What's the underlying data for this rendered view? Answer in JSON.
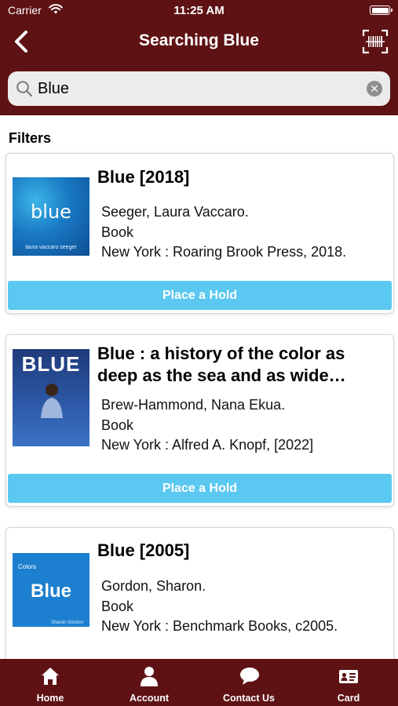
{
  "status_bar": {
    "carrier": "Carrier",
    "time": "11:25 AM"
  },
  "header": {
    "title": "Searching Blue"
  },
  "search": {
    "value": "Blue"
  },
  "filters_label": "Filters",
  "results": [
    {
      "title": "Blue [2018]",
      "author": "Seeger, Laura Vaccaro.",
      "format": "Book",
      "publisher": "New York : Roaring Brook Press, 2018.",
      "cover_text": "blue",
      "cover_sub": "laura vaccaro seeger",
      "action": "Place a Hold"
    },
    {
      "title": "Blue : a history of the color as deep as the sea and as wide…",
      "author": "Brew-Hammond, Nana Ekua.",
      "format": "Book",
      "publisher": "New York : Alfred A. Knopf, [2022]",
      "cover_text": "BLUE",
      "action": "Place a Hold"
    },
    {
      "title": "Blue [2005]",
      "author": "Gordon, Sharon.",
      "format": "Book",
      "publisher": "New York : Benchmark Books, c2005.",
      "cover_text": "Blue",
      "cover_small": "Colors",
      "cover_sub": "Sharon Gordon"
    }
  ],
  "tabbar": {
    "items": [
      {
        "label": "Home",
        "icon": "home-icon"
      },
      {
        "label": "Account",
        "icon": "person-icon"
      },
      {
        "label": "Contact Us",
        "icon": "chat-bubble-icon"
      },
      {
        "label": "Card",
        "icon": "id-card-icon"
      }
    ]
  },
  "colors": {
    "brand": "#5e1214",
    "hold_button": "#5ac8f0",
    "search_background": "#ececec"
  }
}
